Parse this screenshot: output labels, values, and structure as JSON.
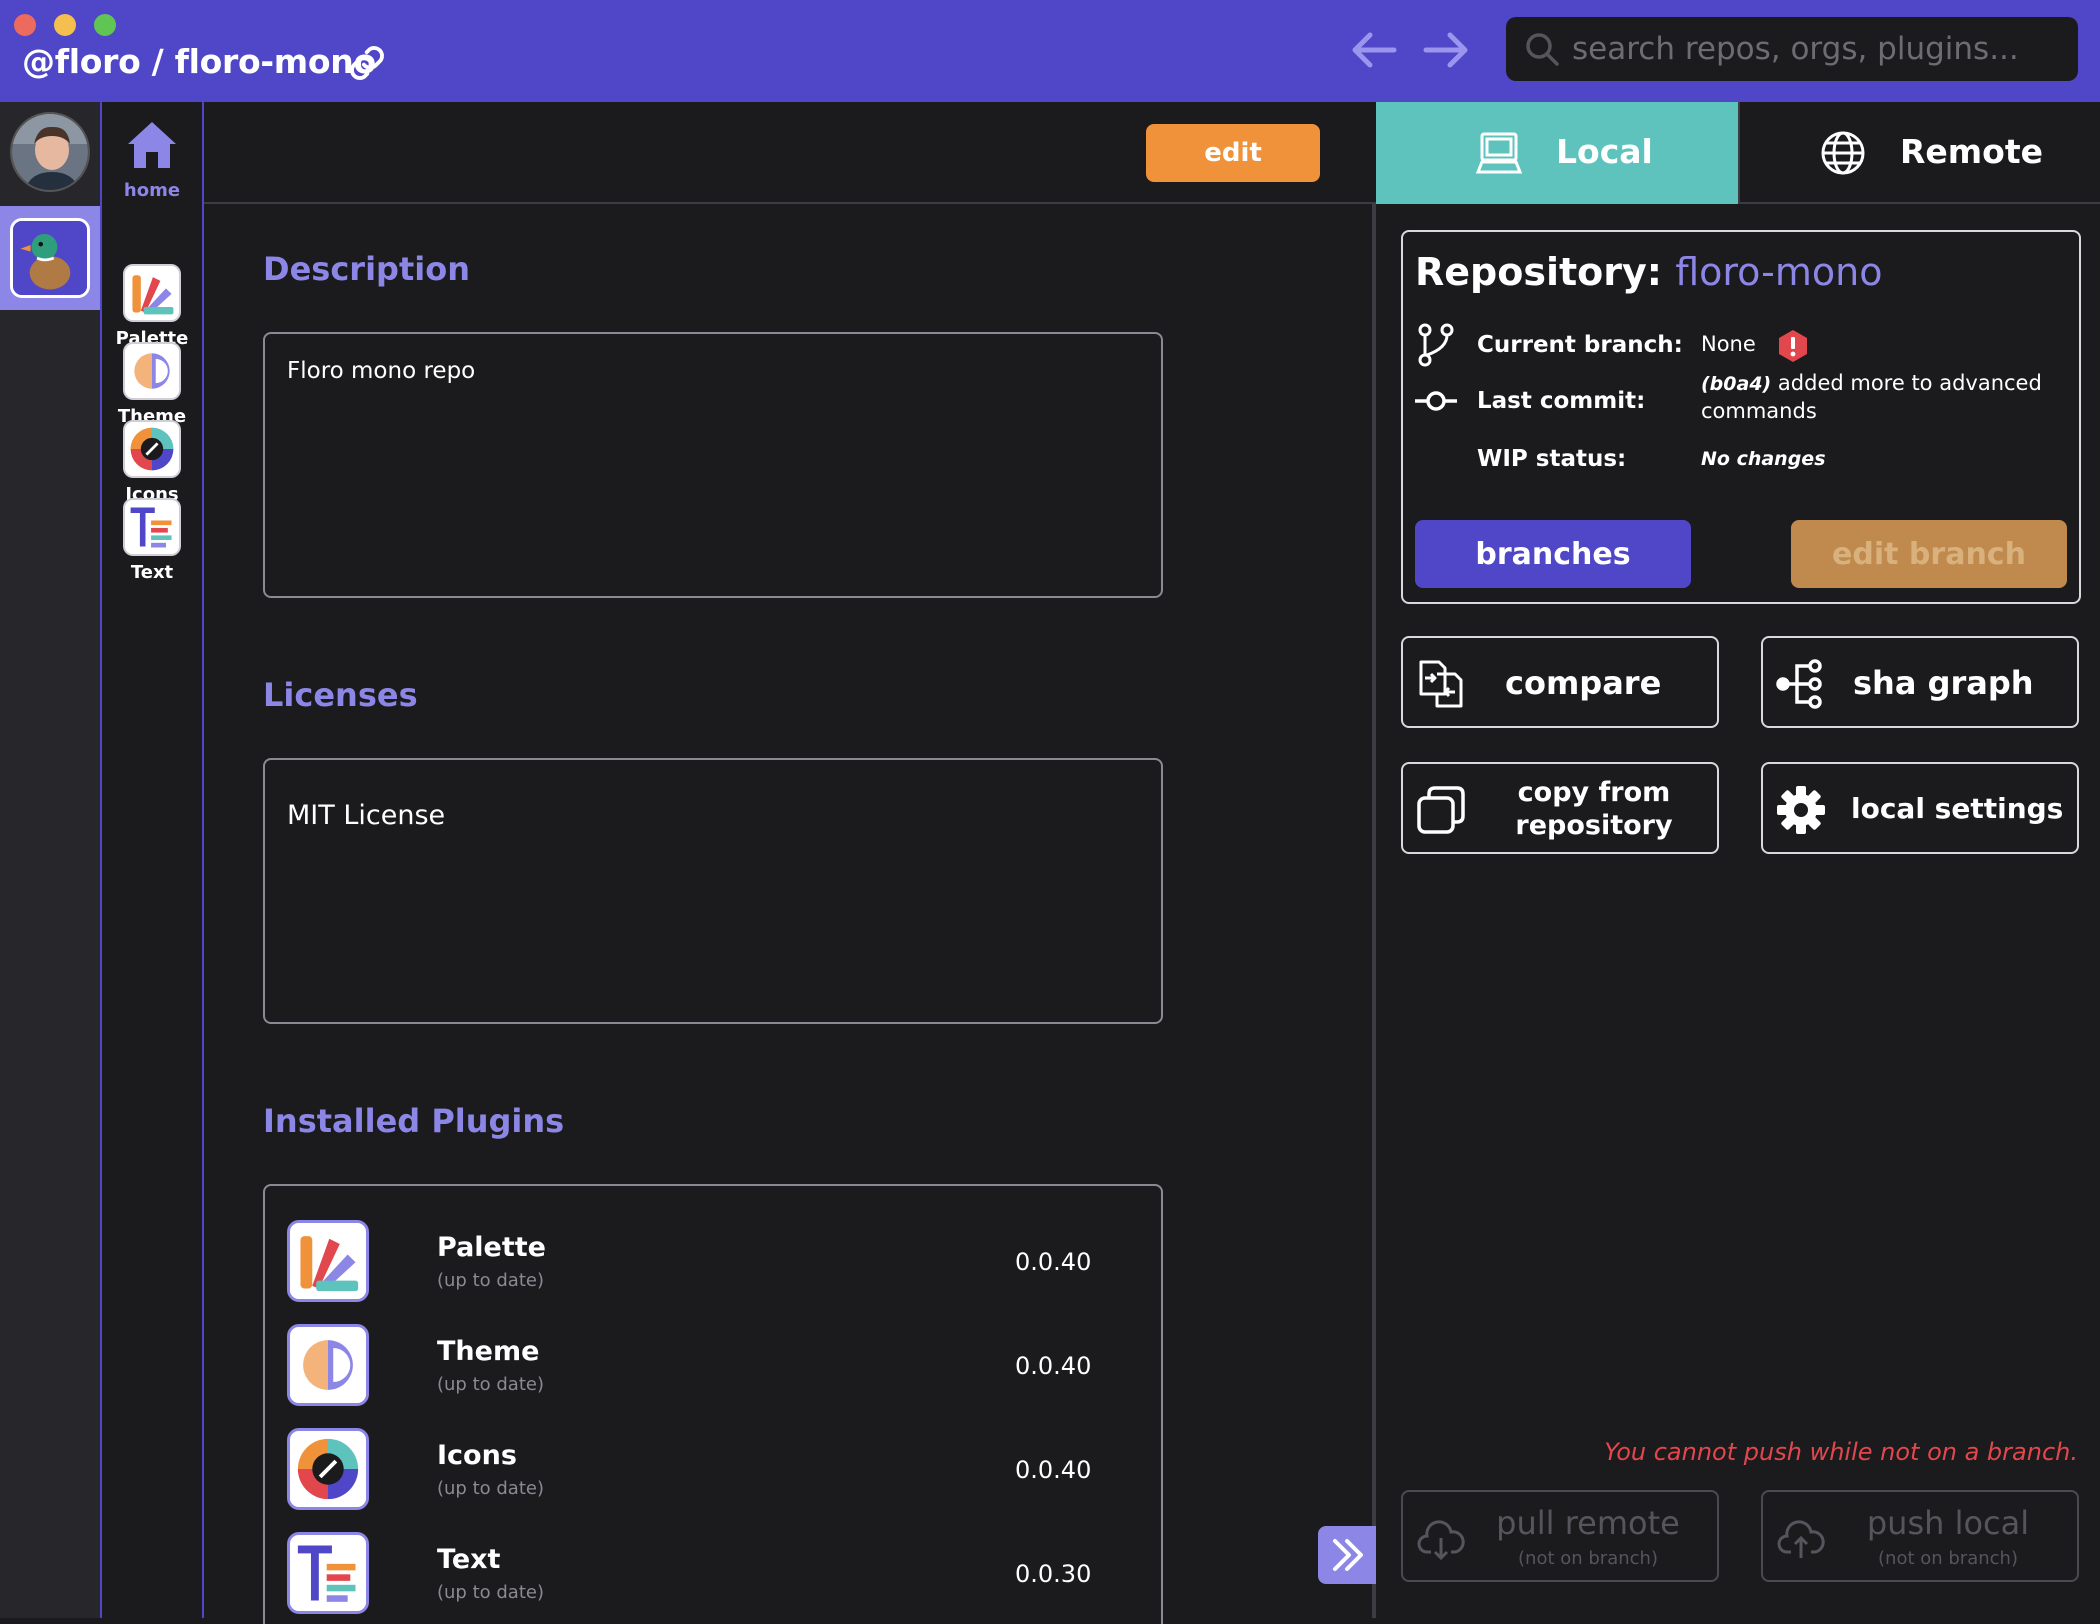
{
  "window": {
    "repo_path": "@floro / floro-mono",
    "search_placeholder": "search repos, orgs, plugins..."
  },
  "plugin_rail": [
    {
      "label": "home"
    },
    {
      "label": "Palette"
    },
    {
      "label": "Theme"
    },
    {
      "label": "Icons"
    },
    {
      "label": "Text"
    }
  ],
  "main": {
    "edit_label": "edit",
    "description_title": "Description",
    "description_text": "Floro mono repo",
    "licenses_title": "Licenses",
    "license_text": "MIT License",
    "plugins_title": "Installed Plugins",
    "plugins": [
      {
        "name": "Palette",
        "status": "(up to date)",
        "version": "0.0.40"
      },
      {
        "name": "Theme",
        "status": "(up to date)",
        "version": "0.0.40"
      },
      {
        "name": "Icons",
        "status": "(up to date)",
        "version": "0.0.40"
      },
      {
        "name": "Text",
        "status": "(up to date)",
        "version": "0.0.30"
      }
    ]
  },
  "right": {
    "tab_local": "Local",
    "tab_remote": "Remote",
    "repo_label": "Repository:",
    "repo_name": "floro-mono",
    "current_branch_label": "Current branch:",
    "current_branch_value": "None",
    "last_commit_label": "Last commit:",
    "last_commit_sha": "(b0a4)",
    "last_commit_msg_1": "added more to advanced",
    "last_commit_msg_2": "commands",
    "wip_label": "WIP status:",
    "wip_value": "No changes",
    "branches_label": "branches",
    "edit_branch_label": "edit branch",
    "compare_label": "compare",
    "sha_graph_label": "sha graph",
    "copy_from_label_1": "copy from",
    "copy_from_label_2": "repository",
    "local_settings_label": "local settings",
    "push_warning": "You cannot push while not on a branch.",
    "pull_remote_label": "pull remote",
    "pull_remote_sub": "(not on branch)",
    "push_local_label": "push local",
    "push_local_sub": "(not on branch)"
  },
  "colors": {
    "accent_purple": "#4f47c7",
    "light_purple": "#8c86e6",
    "teal": "#5fc3bd",
    "orange": "#f0923a",
    "error_red": "#e1474d"
  }
}
